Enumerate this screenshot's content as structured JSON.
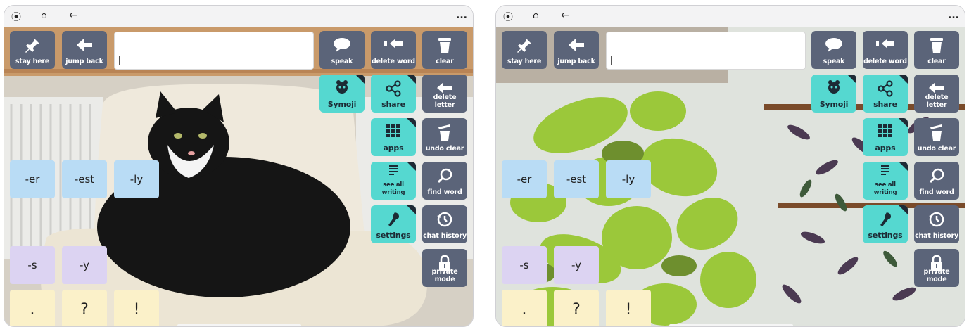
{
  "statusbar": {
    "compass_icon": "compass-icon",
    "home_icon": "home-icon",
    "back_icon": "back-arrow-icon",
    "more": "..."
  },
  "colors": {
    "tile_dark": "#5b6479",
    "tile_teal": "#55d8d0",
    "suffix_blue": "#b9dcf5",
    "suffix_purple": "#dcd3f2",
    "punct_yellow": "#fbf1c9"
  },
  "screens": [
    {
      "background": "cat photo",
      "buttons": {
        "stay_here": "stay here",
        "jump_back": "jump back",
        "speak": "speak",
        "delete_word": "delete word",
        "clear": "clear",
        "symoji": "Symoji",
        "share": "share",
        "delete_letter": "delete letter",
        "apps": "apps",
        "undo_clear": "undo clear",
        "see_all_writing_1": "see all",
        "see_all_writing_2": "writing",
        "find_word": "find word",
        "settings": "settings",
        "chat_history": "chat history",
        "private_mode": "private mode"
      },
      "suffixes": [
        "-er",
        "-est",
        "-ly",
        "-s",
        "-y"
      ],
      "punctuation": [
        ".",
        "?",
        "!"
      ]
    },
    {
      "background": "plant photo",
      "buttons": {
        "stay_here": "stay here",
        "jump_back": "jump back",
        "speak": "speak",
        "delete_word": "delete word",
        "clear": "clear",
        "symoji": "Symoji",
        "share": "share",
        "delete_letter": "delete letter",
        "apps": "apps",
        "undo_clear": "undo clear",
        "see_all_writing_1": "see all",
        "see_all_writing_2": "writing",
        "find_word": "find word",
        "settings": "settings",
        "chat_history": "chat history",
        "private_mode": "private mode"
      },
      "suffixes": [
        "-er",
        "-est",
        "-ly",
        "-s",
        "-y"
      ],
      "punctuation": [
        ".",
        "?",
        "!"
      ]
    }
  ]
}
